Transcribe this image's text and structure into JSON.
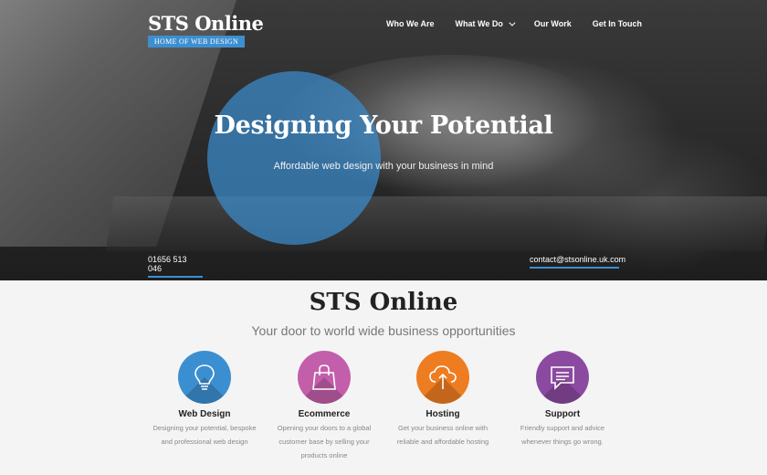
{
  "brand": {
    "name": "STS Online",
    "tagline": "HOME OF WEB DESIGN"
  },
  "nav": {
    "items": [
      {
        "label": "Who We Are"
      },
      {
        "label": "What We Do"
      },
      {
        "label": "Our Work"
      },
      {
        "label": "Get In Touch"
      }
    ]
  },
  "hero": {
    "title": "Designing Your Potential",
    "subtitle": "Affordable web design with your business in mind",
    "phone": "01656 513 046",
    "email": "contact@stsonline.uk.com"
  },
  "intro": {
    "title": "STS Online",
    "subtitle": "Your door to world wide business opportunities"
  },
  "features": [
    {
      "title": "Web Design",
      "icon": "lightbulb-icon",
      "color": "#3b8fd1",
      "desc": "Designing your potential, bespoke and professional web design"
    },
    {
      "title": "Ecommerce",
      "icon": "shopping-bag-icon",
      "color": "#c35eaa",
      "desc": "Opening your doors to a global customer base by selling your products online"
    },
    {
      "title": "Hosting",
      "icon": "cloud-upload-icon",
      "color": "#ee7d22",
      "desc": "Get your business online with reliable and affordable hosting"
    },
    {
      "title": "Support",
      "icon": "speech-bubble-icon",
      "color": "#8b4aa0",
      "desc": "Friendly support and advice whenever things go wrong."
    }
  ]
}
